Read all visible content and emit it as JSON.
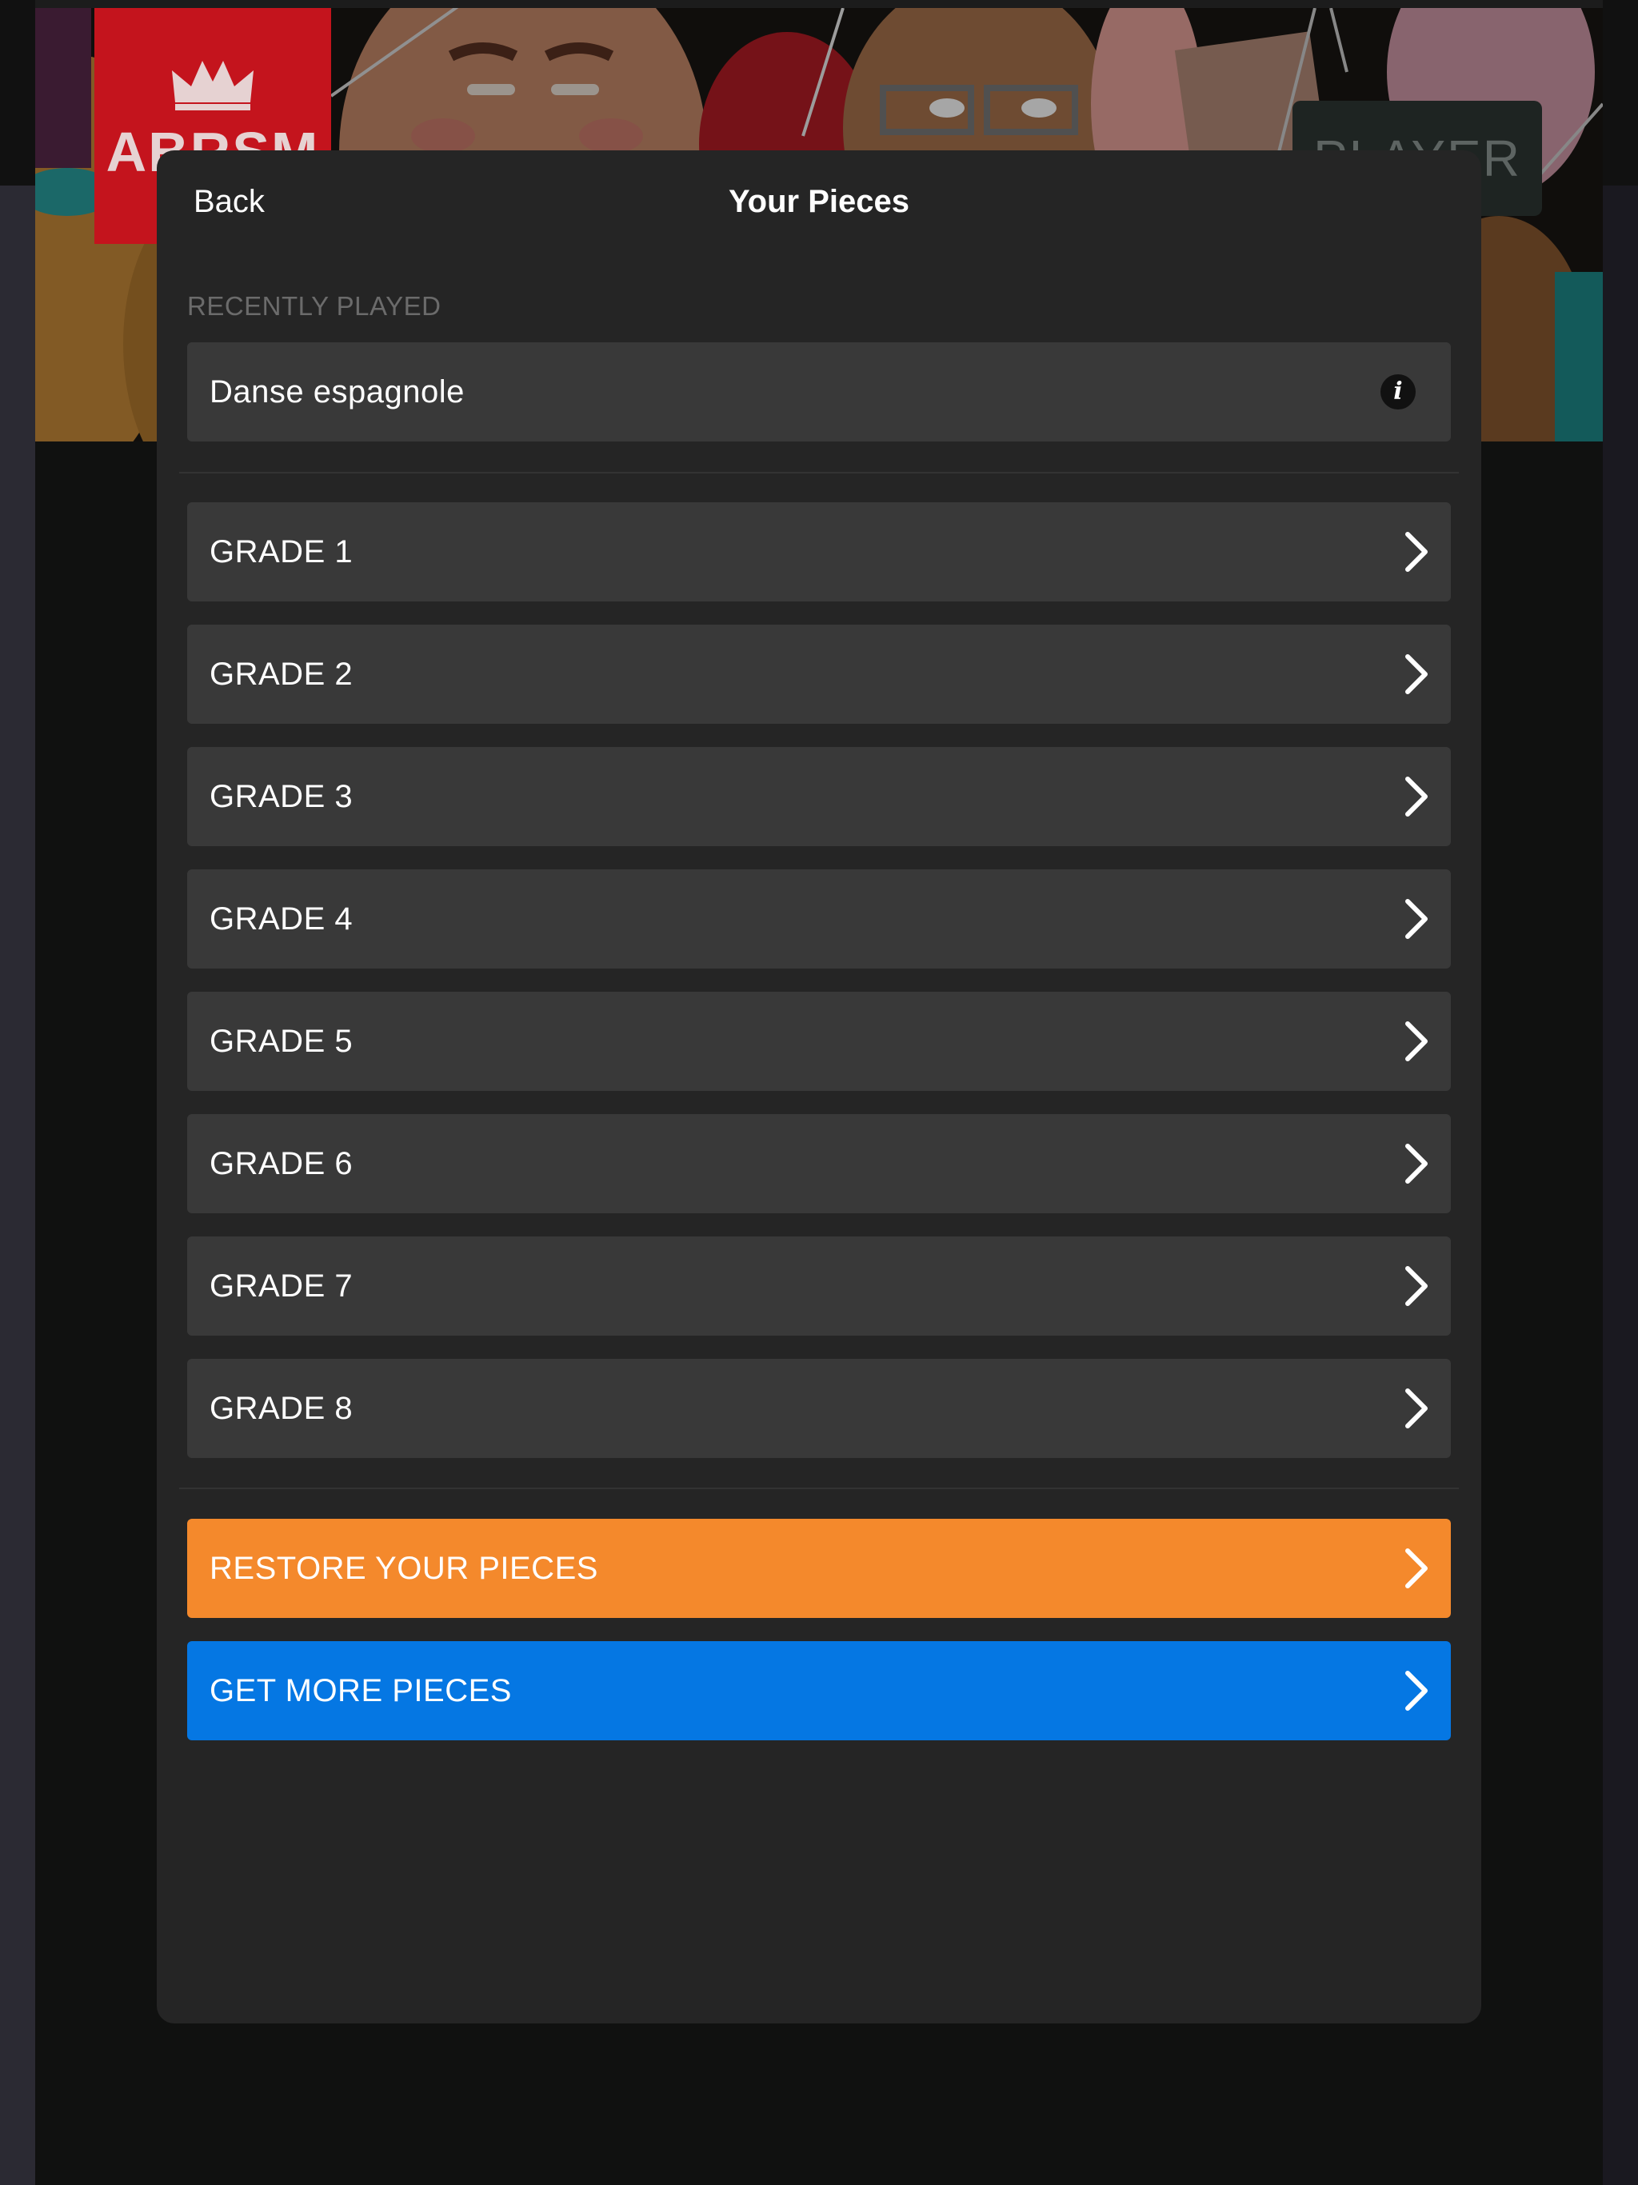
{
  "background": {
    "logo_text": "ABRSM",
    "player_label": "PLAYER"
  },
  "header": {
    "back_label": "Back",
    "title": "Your Pieces"
  },
  "recent": {
    "section_label": "RECENTLY PLAYED",
    "items": [
      {
        "label": "Danse espagnole",
        "info_icon": "i"
      }
    ]
  },
  "grades": [
    {
      "label": "GRADE 1"
    },
    {
      "label": "GRADE 2"
    },
    {
      "label": "GRADE 3"
    },
    {
      "label": "GRADE 4"
    },
    {
      "label": "GRADE 5"
    },
    {
      "label": "GRADE 6"
    },
    {
      "label": "GRADE 7"
    },
    {
      "label": "GRADE 8"
    }
  ],
  "actions": {
    "restore_label": "RESTORE YOUR PIECES",
    "get_more_label": "GET MORE PIECES"
  },
  "colors": {
    "modal": "#252525",
    "row": "#393939",
    "restore": "#f4892c",
    "get_more": "#0577e3",
    "section_label": "#6b6b6b"
  },
  "icons": {
    "row_arrow": "chevron-right-icon",
    "info": "info-icon",
    "logo_mark": "crown-icon"
  }
}
